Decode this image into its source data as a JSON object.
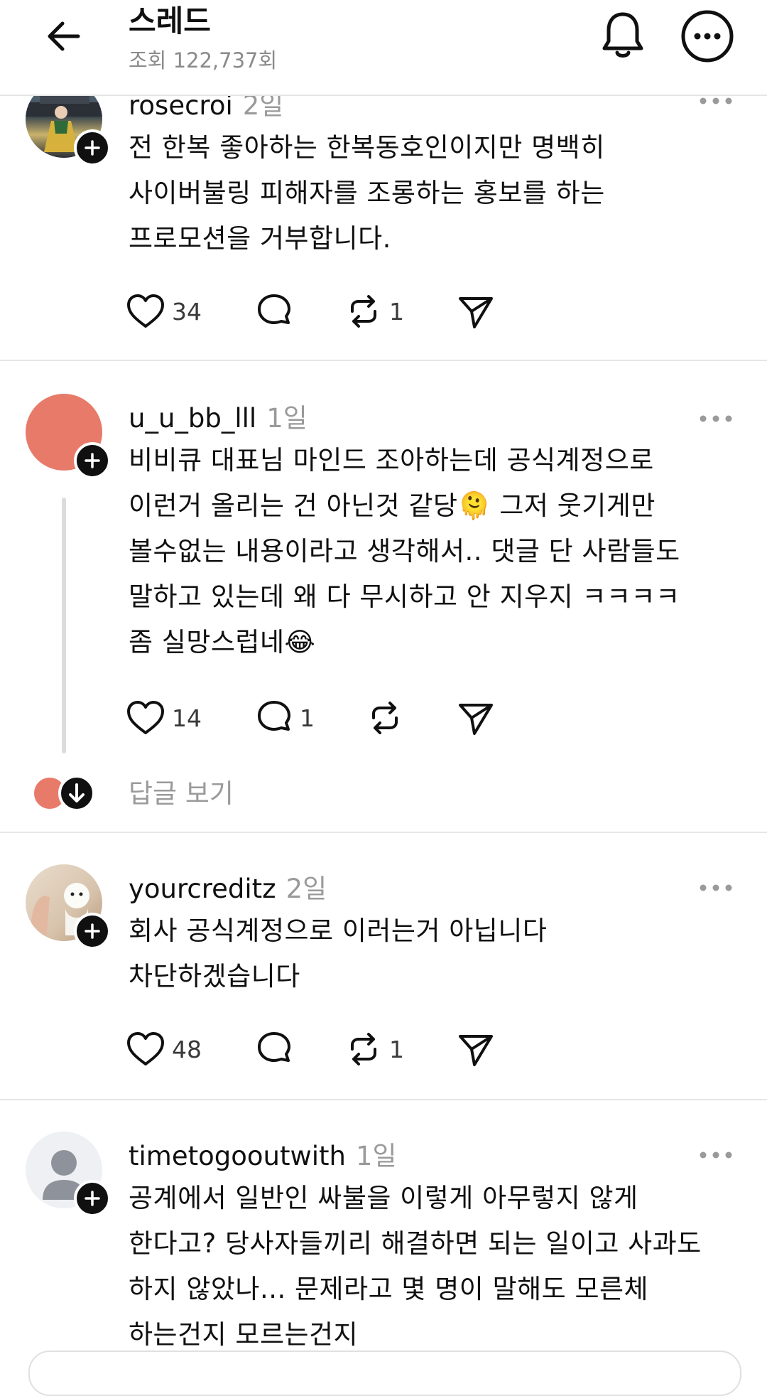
{
  "header": {
    "title": "스레드",
    "views": "조회 122,737회",
    "back_icon": "arrow-left-icon",
    "bell_icon": "bell-icon",
    "more_icon": "more-horizontal-circle-icon"
  },
  "posts": [
    {
      "username": "rosecroi",
      "time": "2일",
      "text": "전 한복 좋아하는 한복동호인이지만 명백히\n사이버불링 피해자를 조롱하는 홍보를 하는\n프로모션을 거부합니다.",
      "likes": "34",
      "comments": "",
      "reposts": "1",
      "avatar": "photo"
    },
    {
      "username": "u_u_bb_lll",
      "time": "1일",
      "text": "비비큐 대표님 마인드 조아하는데 공식계정으로\n이런거 올리는 건 아닌것 같당🫠 그저 웃기게만\n볼수없는 내용이라고 생각해서.. 댓글 단 사람들도\n말하고 있는데 왜 다 무시하고 안 지우지 ㅋㅋㅋㅋ\n좀 실망스럽네😂",
      "likes": "14",
      "comments": "1",
      "reposts": "",
      "avatar_color": "#e87a6a",
      "replies_label": "답글 보기"
    },
    {
      "username": "yourcreditz",
      "time": "2일",
      "text": "회사 공식계정으로 이러는거 아닙니다\n차단하겠습니다",
      "likes": "48",
      "comments": "",
      "reposts": "1",
      "avatar": "photo"
    },
    {
      "username": "timetogooutwith",
      "time": "1일",
      "text": "공계에서 일반인 싸불을 이렇게 아무렇지 않게\n한다고? 당사자들끼리 해결하면 되는 일이고 사과도\n하지 않았나... 문제라고 몇 명이 말해도 모른체\n하는건지 모르는건지",
      "avatar": "default-user"
    }
  ],
  "icons": {
    "like": "heart-icon",
    "comment": "comment-bubble-icon",
    "repost": "repost-icon",
    "share": "send-icon",
    "follow": "plus-icon",
    "post_more": "ellipsis-icon"
  }
}
